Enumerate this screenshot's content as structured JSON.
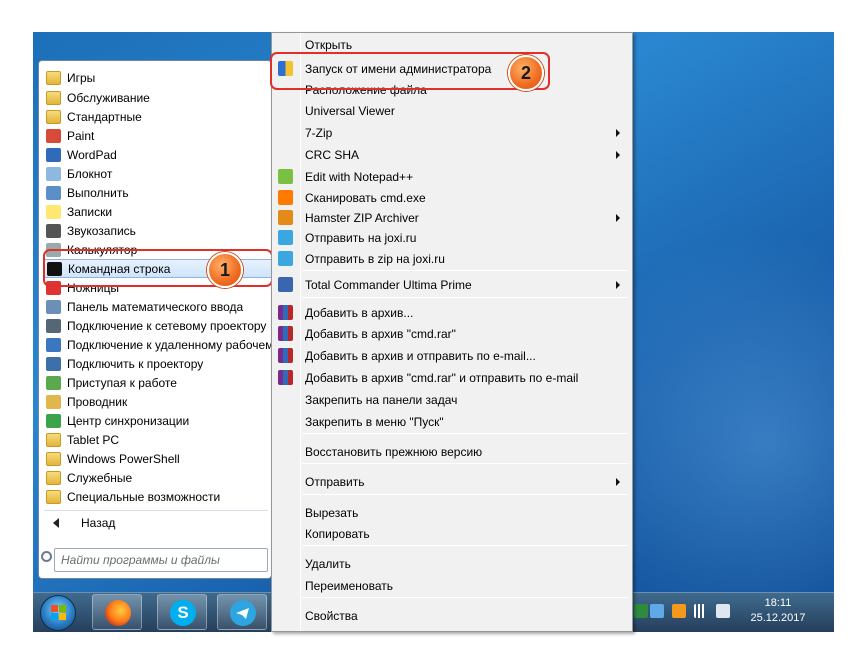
{
  "start_menu": {
    "programs": [
      {
        "label": "Игры",
        "icon": "folder-icon"
      },
      {
        "label": "Обслуживание",
        "icon": "folder-icon"
      },
      {
        "label": "Стандартные",
        "icon": "folder-icon"
      },
      {
        "label": "Paint",
        "icon": "paint-icon"
      },
      {
        "label": "WordPad",
        "icon": "wordpad-icon"
      },
      {
        "label": "Блокнот",
        "icon": "notepad-icon"
      },
      {
        "label": "Выполнить",
        "icon": "run-icon"
      },
      {
        "label": "Записки",
        "icon": "sticky-notes-icon"
      },
      {
        "label": "Звукозапись",
        "icon": "microphone-icon"
      },
      {
        "label": "Калькулятор",
        "icon": "calculator-icon"
      },
      {
        "label": "Командная строка",
        "icon": "cmd-icon"
      },
      {
        "label": "Ножницы",
        "icon": "scissors-icon"
      },
      {
        "label": "Панель математического ввода",
        "icon": "math-input-icon"
      },
      {
        "label": "Подключение к сетевому проектору",
        "icon": "network-projector-icon"
      },
      {
        "label": "Подключение к удаленному рабочему столу",
        "icon": "remote-desktop-icon"
      },
      {
        "label": "Подключить к проектору",
        "icon": "projector-icon"
      },
      {
        "label": "Приступая к работе",
        "icon": "getting-started-icon"
      },
      {
        "label": "Проводник",
        "icon": "explorer-icon"
      },
      {
        "label": "Центр синхронизации",
        "icon": "sync-center-icon"
      },
      {
        "label": "Tablet PC",
        "icon": "folder-icon"
      },
      {
        "label": "Windows PowerShell",
        "icon": "folder-icon"
      },
      {
        "label": "Служебные",
        "icon": "folder-icon"
      },
      {
        "label": "Специальные возможности",
        "icon": "folder-icon"
      }
    ],
    "back_label": "Назад",
    "search_placeholder": "Найти программы и файлы"
  },
  "context_menu": {
    "items": [
      {
        "label": "Открыть",
        "icon": "",
        "submenu": false
      },
      {
        "label": "Запуск от имени администратора",
        "icon": "uac-shield-icon",
        "submenu": false
      },
      {
        "label": "Расположение файла",
        "icon": "",
        "submenu": false
      },
      {
        "label": "Universal Viewer",
        "icon": "",
        "submenu": false
      },
      {
        "label": "7-Zip",
        "icon": "",
        "submenu": true
      },
      {
        "label": "CRC SHA",
        "icon": "",
        "submenu": true
      },
      {
        "label": "Edit with Notepad++",
        "icon": "notepadpp-icon",
        "submenu": false
      },
      {
        "label": "Сканировать cmd.exe",
        "icon": "avast-icon",
        "submenu": false
      },
      {
        "label": "Hamster ZIP Archiver",
        "icon": "hamster-icon",
        "submenu": true
      },
      {
        "label": "Отправить на joxi.ru",
        "icon": "joxi-icon",
        "submenu": false
      },
      {
        "label": "Отправить в zip на joxi.ru",
        "icon": "joxi-icon",
        "submenu": false
      },
      {
        "label": "Total Commander Ultima Prime",
        "icon": "total-commander-icon",
        "submenu": true
      },
      {
        "label": "Добавить в архив...",
        "icon": "winrar-icon",
        "submenu": false
      },
      {
        "label": "Добавить в архив \"cmd.rar\"",
        "icon": "winrar-icon",
        "submenu": false
      },
      {
        "label": "Добавить в архив и отправить по e-mail...",
        "icon": "winrar-icon",
        "submenu": false
      },
      {
        "label": "Добавить в архив \"cmd.rar\" и отправить по e-mail",
        "icon": "winrar-icon",
        "submenu": false
      },
      {
        "label": "Закрепить на панели задач",
        "icon": "",
        "submenu": false
      },
      {
        "label": "Закрепить в меню \"Пуск\"",
        "icon": "",
        "submenu": false
      },
      {
        "label": "Восстановить прежнюю версию",
        "icon": "",
        "submenu": false
      },
      {
        "label": "Отправить",
        "icon": "",
        "submenu": true
      },
      {
        "label": "Вырезать",
        "icon": "",
        "submenu": false
      },
      {
        "label": "Копировать",
        "icon": "",
        "submenu": false
      },
      {
        "label": "Удалить",
        "icon": "",
        "submenu": false
      },
      {
        "label": "Переименовать",
        "icon": "",
        "submenu": false
      },
      {
        "label": "Свойства",
        "icon": "",
        "submenu": false
      }
    ]
  },
  "callouts": {
    "step1": "1",
    "step2": "2"
  },
  "taskbar": {
    "pinned": [
      "firefox-icon",
      "skype-icon",
      "telegram-icon"
    ],
    "clock_time": "18:11",
    "clock_date": "25.12.2017"
  },
  "colors": {
    "desktop": "#1c6fb8",
    "callout_border": "#e0302b",
    "badge": "#f06b1f",
    "selection": "#cfe4fb"
  }
}
